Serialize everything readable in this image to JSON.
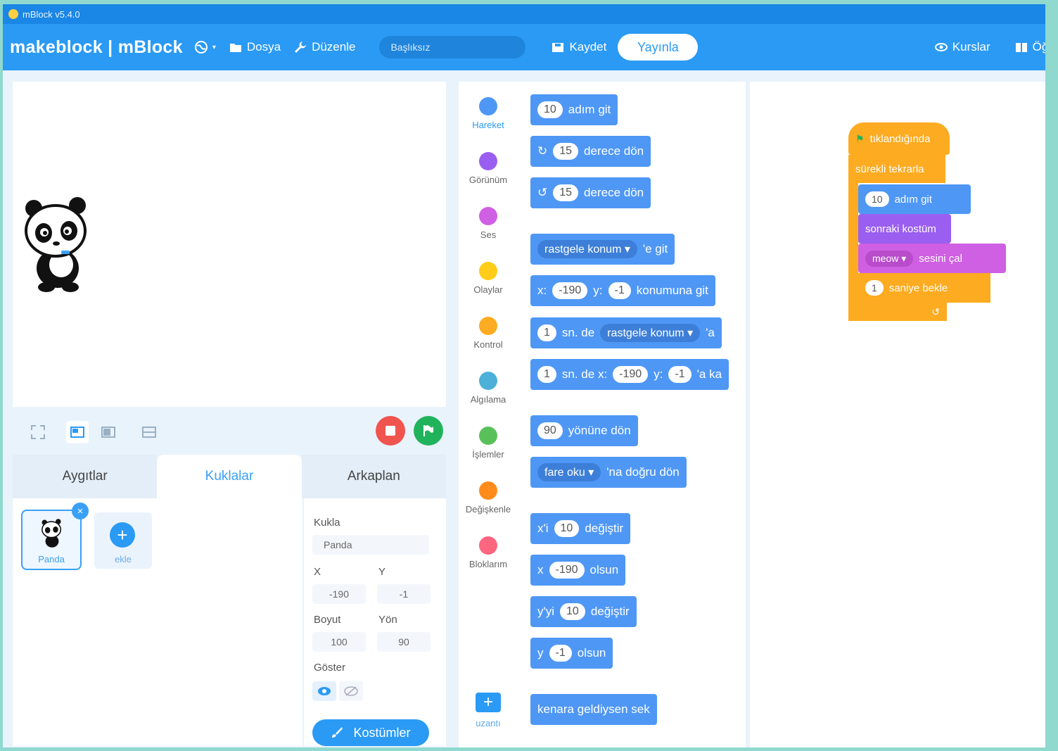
{
  "window": {
    "title": "mBlock v5.4.0"
  },
  "menubar": {
    "brand": "makeblock | mBlock",
    "file": "Dosya",
    "edit": "Düzenle",
    "project_title": "Başlıksız",
    "save": "Kaydet",
    "publish": "Yayınla",
    "courses": "Kurslar",
    "tutorials": "Öğr"
  },
  "stage_tabs": {
    "devices": "Aygıtlar",
    "sprites": "Kuklalar",
    "backdrops": "Arkaplan"
  },
  "sprite_list": {
    "sprite_name": "Panda",
    "add_label": "ekle"
  },
  "properties": {
    "sprite_label": "Kukla",
    "sprite_value": "Panda",
    "x_label": "X",
    "x_value": "-190",
    "y_label": "Y",
    "y_value": "-1",
    "size_label": "Boyut",
    "size_value": "100",
    "direction_label": "Yön",
    "direction_value": "90",
    "show_label": "Göster",
    "costumes_button": "Kostümler"
  },
  "categories": [
    {
      "label": "Hareket",
      "color": "#4e97f5"
    },
    {
      "label": "Görünüm",
      "color": "#9a5ff1"
    },
    {
      "label": "Ses",
      "color": "#cf5fe3"
    },
    {
      "label": "Olaylar",
      "color": "#ffcc1a"
    },
    {
      "label": "Kontrol",
      "color": "#fdab20"
    },
    {
      "label": "Algılama",
      "color": "#4cb0d8"
    },
    {
      "label": "İşlemler",
      "color": "#5ac15a"
    },
    {
      "label": "Değişkenle",
      "color": "#ff8c1a"
    },
    {
      "label": "Bloklarım",
      "color": "#ff6680"
    }
  ],
  "extension": {
    "label": "uzantı"
  },
  "palette": {
    "move": {
      "value": "10",
      "text": "adım git"
    },
    "turn_right": {
      "value": "15",
      "text": "derece dön"
    },
    "turn_left": {
      "value": "15",
      "text": "derece dön"
    },
    "goto": {
      "dropdown": "rastgele konum",
      "text": "'e git"
    },
    "goto_xy": {
      "x_label": "x:",
      "x": "-190",
      "y_label": "y:",
      "y": "-1",
      "text": "konumuna git"
    },
    "glide": {
      "value": "1",
      "text": "sn. de",
      "dropdown": "rastgele konum",
      "suffix": "'a"
    },
    "glide_xy": {
      "value": "1",
      "text": "sn. de x:",
      "x": "-190",
      "y_label": "y:",
      "y": "-1",
      "suffix": "'a ka"
    },
    "point_dir": {
      "value": "90",
      "text": "yönüne dön"
    },
    "point_towards": {
      "dropdown": "fare oku",
      "text": "'na doğru dön"
    },
    "change_x": {
      "label": "x'i",
      "value": "10",
      "text": "değiştir"
    },
    "set_x": {
      "label": "x",
      "value": "-190",
      "text": "olsun"
    },
    "change_y": {
      "label": "y'yi",
      "value": "10",
      "text": "değiştir"
    },
    "set_y": {
      "label": "y",
      "value": "-1",
      "text": "olsun"
    },
    "bounce": {
      "text": "kenara geldiysen sek"
    }
  },
  "script": {
    "hat": "tıklandığında",
    "forever": "sürekli tekrarla",
    "move": {
      "value": "10",
      "text": "adım git"
    },
    "next_costume": "sonraki kostüm",
    "play_sound": {
      "dropdown": "meow",
      "text": "sesini çal"
    },
    "wait": {
      "value": "1",
      "text": "saniye bekle"
    }
  }
}
